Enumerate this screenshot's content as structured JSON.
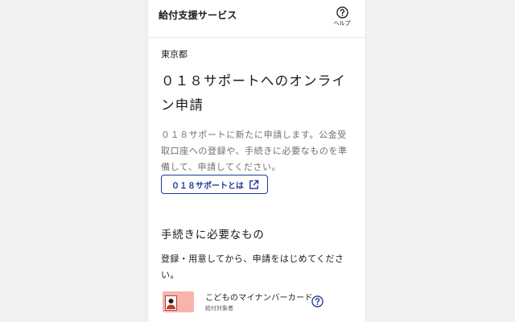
{
  "header": {
    "title": "給付支援サービス",
    "help_label": "ヘルプ"
  },
  "main": {
    "prefecture": "東京都",
    "title": "０１８サポートへのオンライン申請",
    "description": "０１８サポートに新たに申請します。公金受取口座への登録や、手続きに必要なものを準備して、申請してください。",
    "about_button_label": "０１８サポートとは"
  },
  "requirements": {
    "heading": "手続きに必要なもの",
    "note": "登録・用意してから、申請をはじめてください。",
    "items": [
      {
        "title": "こどものマイナンバーカード",
        "subtitle": "給付対象者",
        "icon": "id-card-icon"
      }
    ]
  },
  "colors": {
    "accent": "#1d3994",
    "card_pink": "#f8b3ad",
    "muted_text": "#707070"
  }
}
